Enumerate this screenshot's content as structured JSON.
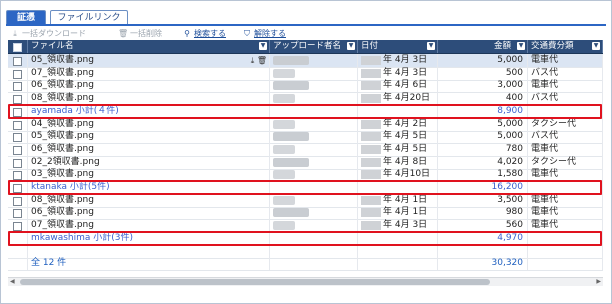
{
  "tabs": {
    "active": "証憑",
    "inactive": "ファイルリンク"
  },
  "toolbar": {
    "bulk_download": "一括ダウンロード",
    "bulk_delete": "一括削除",
    "search": "検索する",
    "clear": "解除する",
    "icons": {
      "download": "download-icon",
      "delete": "trash-icon",
      "search": "search-icon",
      "clear": "filter-clear-icon"
    }
  },
  "columns": [
    "ファイル名",
    "アップロード者名",
    "日付",
    "金額",
    "交通費分類"
  ],
  "rows": [
    {
      "type": "data",
      "name": "05_領収書.png",
      "date_rest": "年  4月  3日",
      "amount": "5,000",
      "category": "電車代",
      "selected": true
    },
    {
      "type": "data",
      "name": "07_領収書.png",
      "date_rest": "年  4月  3日",
      "amount": "500",
      "category": "バス代"
    },
    {
      "type": "data",
      "name": "06_領収書.png",
      "date_rest": "年  4月  6日",
      "amount": "3,000",
      "category": "電車代"
    },
    {
      "type": "data",
      "name": "08_領収書.png",
      "date_rest": "年  4月20日",
      "amount": "400",
      "category": "バス代"
    },
    {
      "type": "subtotal",
      "label": "ayamada  小計(４件)",
      "amount": "8,900"
    },
    {
      "type": "data",
      "name": "04_領収書.png",
      "date_rest": "年  4月  2日",
      "amount": "5,000",
      "category": "タクシー代"
    },
    {
      "type": "data",
      "name": "05_領収書.png",
      "date_rest": "年  4月  5日",
      "amount": "5,000",
      "category": "バス代"
    },
    {
      "type": "data",
      "name": "06_領収書.png",
      "date_rest": "年  4月  5日",
      "amount": "780",
      "category": "電車代"
    },
    {
      "type": "data",
      "name": "02_2領収書.png",
      "date_rest": "年  4月  8日",
      "amount": "4,020",
      "category": "タクシー代"
    },
    {
      "type": "data",
      "name": "03_領収書.png",
      "date_rest": "年  4月10日",
      "amount": "1,580",
      "category": "電車代"
    },
    {
      "type": "subtotal",
      "label": "ktanaka  小計(5件)",
      "amount": "16,200"
    },
    {
      "type": "data",
      "name": "08_領収書.png",
      "date_rest": "年  4月  1日",
      "amount": "3,500",
      "category": "電車代"
    },
    {
      "type": "data",
      "name": "06_領収書.png",
      "date_rest": "年  4月  1日",
      "amount": "980",
      "category": "電車代"
    },
    {
      "type": "data",
      "name": "07_領収書.png",
      "date_rest": "年  4月  3日",
      "amount": "560",
      "category": "電車代"
    },
    {
      "type": "subtotal",
      "label": "mkawashima  小計(3件)",
      "amount": "4,970",
      "nocheck": true
    },
    {
      "type": "blank"
    },
    {
      "type": "total",
      "label": "全 12 件",
      "amount": "30,320"
    }
  ],
  "row_actions": {
    "download": "download-icon",
    "delete": "trash-icon"
  },
  "highlight_color": "#e0121e"
}
